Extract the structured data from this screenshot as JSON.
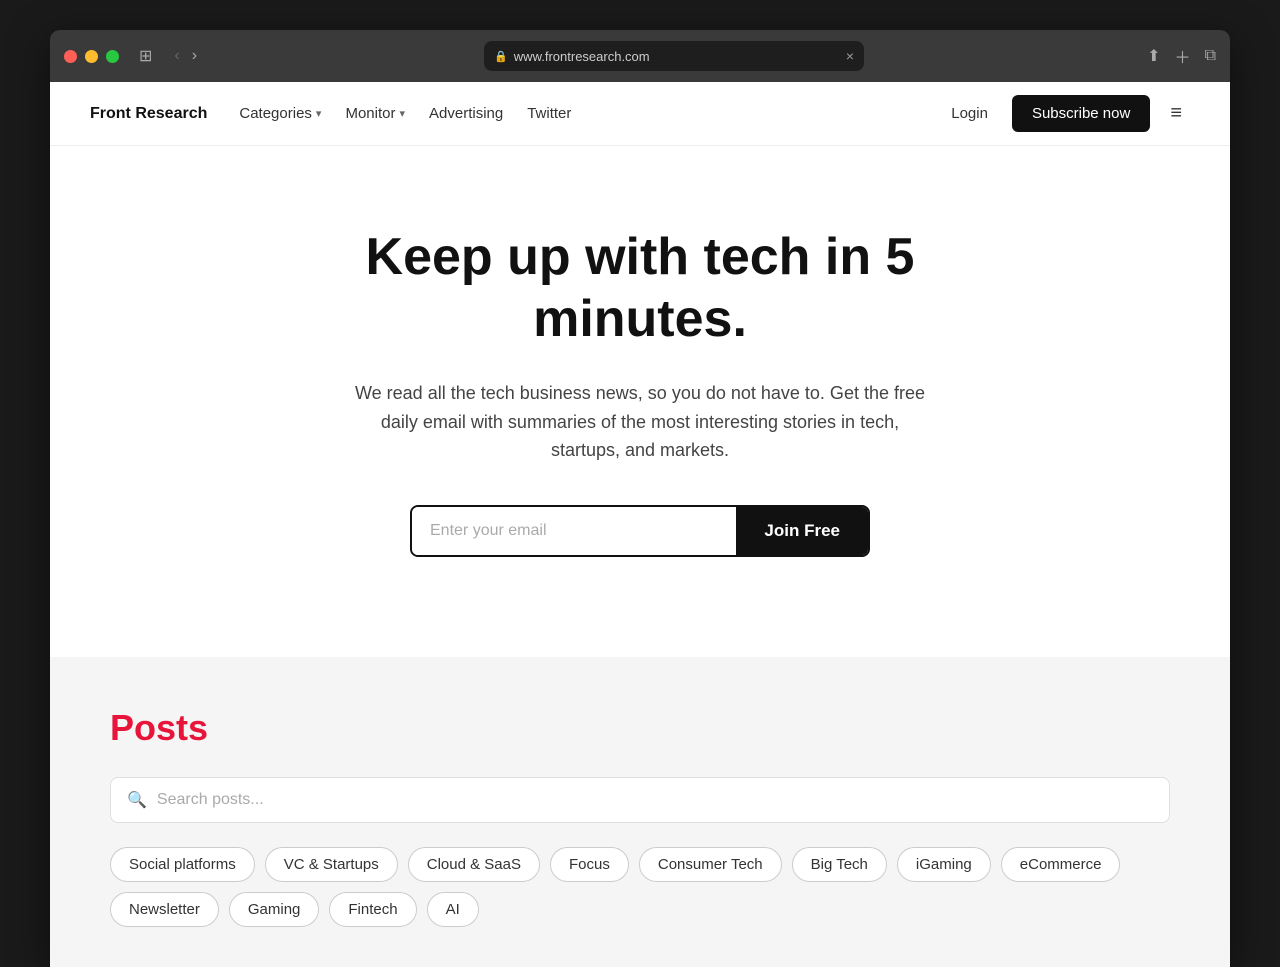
{
  "browser": {
    "url": "www.frontresearch.com",
    "tab_close_label": "×"
  },
  "navbar": {
    "brand": "Front Research",
    "links": [
      {
        "label": "Categories",
        "has_dropdown": true
      },
      {
        "label": "Monitor",
        "has_dropdown": true
      },
      {
        "label": "Advertising",
        "has_dropdown": false
      },
      {
        "label": "Twitter",
        "has_dropdown": false
      }
    ],
    "login_label": "Login",
    "subscribe_label": "Subscribe now"
  },
  "hero": {
    "title": "Keep up with tech in 5 minutes.",
    "subtitle": "We read all the tech business news, so you do not have to. Get the free daily email with summaries of the most interesting stories in tech, startups, and markets.",
    "email_placeholder": "Enter your email",
    "join_label": "Join Free"
  },
  "posts": {
    "title": "Posts",
    "search_placeholder": "Search posts...",
    "tags": [
      "Social platforms",
      "VC & Startups",
      "Cloud & SaaS",
      "Focus",
      "Consumer Tech",
      "Big Tech",
      "iGaming",
      "eCommerce",
      "Newsletter",
      "Gaming",
      "Fintech",
      "AI"
    ]
  }
}
